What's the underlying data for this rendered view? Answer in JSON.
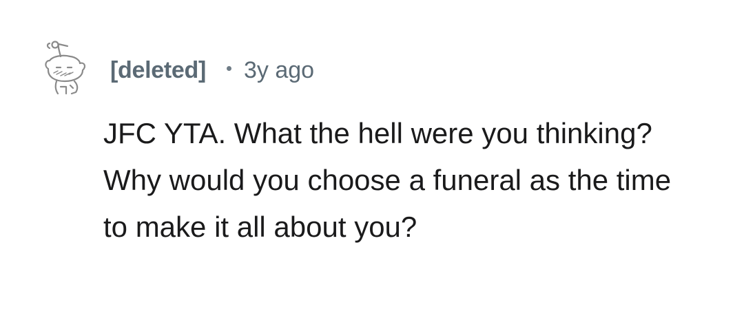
{
  "comment": {
    "author": "[deleted]",
    "separator_icon": "dot-icon",
    "age": "3y ago",
    "avatar_icon": "deleted-user-snoo-icon",
    "body": "JFC YTA. What the hell were you thinking? Why would you choose a funeral as the time to make it all about you?"
  },
  "colors": {
    "meta_text": "#5b6a75",
    "body_text": "#1a1a1b",
    "background": "#ffffff"
  }
}
